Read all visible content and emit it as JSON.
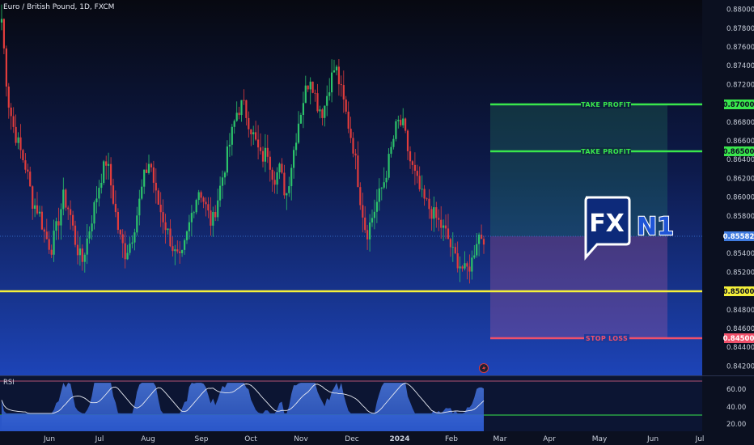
{
  "header": {
    "symbol": "Euro / British Pound, 1D, FXCM"
  },
  "rsi": {
    "label": "RSI",
    "ticks": [
      "60.00",
      "40.00",
      "20.00"
    ]
  },
  "logo": {
    "fx": "FX",
    "n1": "N1"
  },
  "colors": {
    "bg_top": "#080a14",
    "bg_bottom": "#1c3fb0",
    "up": "#2cc26a",
    "down": "#e03c3c",
    "support": "#f5f03a",
    "tp": "#39e64c",
    "sl": "#f0506a",
    "price_tag": "#3f7be0"
  },
  "levels": {
    "take_profit_1": {
      "label": "TAKE PROFIT",
      "value": "0.87000"
    },
    "take_profit_2": {
      "label": "TAKE PROFIT",
      "value": "0.86500"
    },
    "support": {
      "value": "0.85000"
    },
    "stop_loss": {
      "label": "STOP LOSS",
      "value": "0.84500"
    },
    "current": {
      "value": "0.85582"
    }
  },
  "chart_data": {
    "type": "candlestick",
    "symbol": "EURGBP",
    "timeframe": "1D",
    "ylim": [
      0.841,
      0.881
    ],
    "y_ticks": [
      "0.88000",
      "0.87800",
      "0.87600",
      "0.87400",
      "0.87200",
      "0.86800",
      "0.86600",
      "0.86400",
      "0.86200",
      "0.86000",
      "0.85800",
      "0.85400",
      "0.85200",
      "0.84800",
      "0.84600",
      "0.84400",
      "0.84200"
    ],
    "x_ticks": [
      "Jun",
      "Jul",
      "Aug",
      "Sep",
      "Oct",
      "Nov",
      "Dec",
      "2024",
      "Feb",
      "Mar",
      "Apr",
      "May",
      "Jun",
      "Jul"
    ],
    "close_path": [
      [
        0.879
      ],
      [
        0.8705
      ],
      [
        0.8672
      ],
      [
        0.865
      ],
      [
        0.863
      ],
      [
        0.8595
      ],
      [
        0.8585
      ],
      [
        0.856
      ],
      [
        0.8545
      ],
      [
        0.857
      ],
      [
        0.86
      ],
      [
        0.8585
      ],
      [
        0.855
      ],
      [
        0.853
      ],
      [
        0.856
      ],
      [
        0.859
      ],
      [
        0.862
      ],
      [
        0.864
      ],
      [
        0.86
      ],
      [
        0.856
      ],
      [
        0.854
      ],
      [
        0.8555
      ],
      [
        0.8585
      ],
      [
        0.862
      ],
      [
        0.864
      ],
      [
        0.86
      ],
      [
        0.858
      ],
      [
        0.856
      ],
      [
        0.854
      ],
      [
        0.853
      ],
      [
        0.856
      ],
      [
        0.859
      ],
      [
        0.861
      ],
      [
        0.859
      ],
      [
        0.857
      ],
      [
        0.86
      ],
      [
        0.863
      ],
      [
        0.866
      ],
      [
        0.869
      ],
      [
        0.87
      ],
      [
        0.868
      ],
      [
        0.866
      ],
      [
        0.864
      ],
      [
        0.865
      ],
      [
        0.862
      ],
      [
        0.863
      ],
      [
        0.86
      ],
      [
        0.864
      ],
      [
        0.868
      ],
      [
        0.871
      ],
      [
        0.873
      ],
      [
        0.87
      ],
      [
        0.869
      ],
      [
        0.872
      ],
      [
        0.874
      ],
      [
        0.871
      ],
      [
        0.868
      ],
      [
        0.865
      ],
      [
        0.86
      ],
      [
        0.856
      ],
      [
        0.858
      ],
      [
        0.86
      ],
      [
        0.862
      ],
      [
        0.865
      ],
      [
        0.868
      ],
      [
        0.8675
      ],
      [
        0.864
      ],
      [
        0.862
      ],
      [
        0.86
      ],
      [
        0.859
      ],
      [
        0.858
      ],
      [
        0.857
      ],
      [
        0.856
      ],
      [
        0.854
      ],
      [
        0.853
      ],
      [
        0.852
      ],
      [
        0.853
      ],
      [
        0.856
      ],
      [
        0.8558
      ]
    ]
  }
}
